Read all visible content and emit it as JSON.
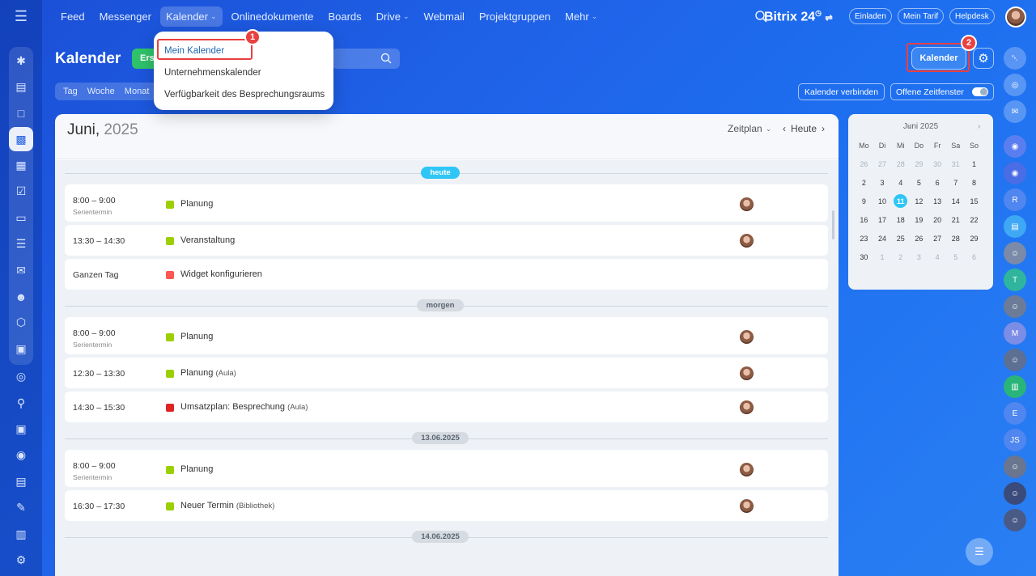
{
  "nav": {
    "items": [
      {
        "label": "Feed",
        "chevron": false,
        "open": false
      },
      {
        "label": "Messenger",
        "chevron": false,
        "open": false
      },
      {
        "label": "Kalender",
        "chevron": true,
        "open": true
      },
      {
        "label": "Onlinedokumente",
        "chevron": false,
        "open": false
      },
      {
        "label": "Boards",
        "chevron": false,
        "open": false
      },
      {
        "label": "Drive",
        "chevron": true,
        "open": false
      },
      {
        "label": "Webmail",
        "chevron": false,
        "open": false
      },
      {
        "label": "Projektgruppen",
        "chevron": false,
        "open": false
      },
      {
        "label": "Mehr",
        "chevron": true,
        "open": false
      }
    ]
  },
  "header": {
    "brand": "Bitrix 24",
    "invite_label": "Einladen",
    "tariff_label": "Mein Tarif",
    "helpdesk_label": "Helpdesk"
  },
  "page": {
    "title": "Kalender",
    "create_label": "Ers",
    "view_tabs": [
      "Tag",
      "Woche",
      "Monat"
    ],
    "kalender_button": "Kalender",
    "connect_label": "Kalender verbinden",
    "open_slots_label": "Offene Zeitfenster"
  },
  "dropdown": {
    "items": [
      "Mein Kalender",
      "Unternehmenskalender",
      "Verfügbarkeit des Besprechungsraums"
    ]
  },
  "badges": {
    "first": "1",
    "second": "2"
  },
  "panel": {
    "month": "Juni,",
    "year": "2025",
    "mode_label": "Zeitplan",
    "today_label": "Heute"
  },
  "days": [
    {
      "label": "heute",
      "color": "#2fc6f6",
      "text_color": "#ffffff",
      "events": [
        {
          "time": "8:00 – 9:00",
          "sub": "Serientermin",
          "title": "Planung",
          "loc": "",
          "color": "#9dcf00",
          "avatar": true
        },
        {
          "time": "13:30 – 14:30",
          "sub": "",
          "title": "Veranstaltung",
          "loc": "",
          "color": "#9dcf00",
          "avatar": true
        },
        {
          "time": "Ganzen Tag",
          "sub": "",
          "title": "Widget konfigurieren",
          "loc": "",
          "color": "#ff5752",
          "avatar": false
        }
      ]
    },
    {
      "label": "morgen",
      "color": "#d5dbe1",
      "text_color": "#5a6470",
      "events": [
        {
          "time": "8:00 – 9:00",
          "sub": "Serientermin",
          "title": "Planung",
          "loc": "",
          "color": "#9dcf00",
          "avatar": true
        },
        {
          "time": "12:30 – 13:30",
          "sub": "",
          "title": "Planung",
          "loc": "(Aula)",
          "color": "#9dcf00",
          "avatar": true
        },
        {
          "time": "14:30 – 15:30",
          "sub": "",
          "title": "Umsatzplan: Besprechung",
          "loc": "(Aula)",
          "color": "#e02424",
          "avatar": true
        }
      ]
    },
    {
      "label": "13.06.2025",
      "color": "#d5dbe1",
      "text_color": "#5a6470",
      "events": [
        {
          "time": "8:00 – 9:00",
          "sub": "Serientermin",
          "title": "Planung",
          "loc": "",
          "color": "#9dcf00",
          "avatar": true
        },
        {
          "time": "16:30 – 17:30",
          "sub": "",
          "title": "Neuer Termin",
          "loc": "(Bibliothek)",
          "color": "#9dcf00",
          "avatar": true
        }
      ]
    },
    {
      "label": "14.06.2025",
      "color": "#d5dbe1",
      "text_color": "#5a6470",
      "events": []
    }
  ],
  "mini_calendar": {
    "title": "Juni 2025",
    "weekdays": [
      "Mo",
      "Di",
      "Mi",
      "Do",
      "Fr",
      "Sa",
      "So"
    ],
    "weeks": [
      [
        [
          "26",
          true
        ],
        [
          "27",
          true
        ],
        [
          "28",
          true
        ],
        [
          "29",
          true
        ],
        [
          "30",
          true
        ],
        [
          "31",
          true
        ],
        [
          "1",
          false
        ]
      ],
      [
        [
          "2",
          false
        ],
        [
          "3",
          false
        ],
        [
          "4",
          false
        ],
        [
          "5",
          false
        ],
        [
          "6",
          false
        ],
        [
          "7",
          false
        ],
        [
          "8",
          false
        ]
      ],
      [
        [
          "9",
          false
        ],
        [
          "10",
          false
        ],
        [
          "11",
          false
        ],
        [
          "12",
          false
        ],
        [
          "13",
          false
        ],
        [
          "14",
          false
        ],
        [
          "15",
          false
        ]
      ],
      [
        [
          "16",
          false
        ],
        [
          "17",
          false
        ],
        [
          "18",
          false
        ],
        [
          "19",
          false
        ],
        [
          "20",
          false
        ],
        [
          "21",
          false
        ],
        [
          "22",
          false
        ]
      ],
      [
        [
          "23",
          false
        ],
        [
          "24",
          false
        ],
        [
          "25",
          false
        ],
        [
          "26",
          false
        ],
        [
          "27",
          false
        ],
        [
          "28",
          false
        ],
        [
          "29",
          false
        ]
      ],
      [
        [
          "30",
          false
        ],
        [
          "1",
          true
        ],
        [
          "2",
          true
        ],
        [
          "3",
          true
        ],
        [
          "4",
          true
        ],
        [
          "5",
          true
        ],
        [
          "6",
          true
        ]
      ]
    ],
    "today": "11"
  },
  "right_rail": [
    {
      "icon": "bell-icon",
      "label": "",
      "color": "rgba(255,255,255,0.25)"
    },
    {
      "icon": "copilot-icon",
      "label": "",
      "color": "rgba(255,255,255,0.25)"
    },
    {
      "icon": "chat-icon",
      "label": "",
      "color": "rgba(255,255,255,0.25)"
    },
    {
      "icon": "copilot-round-icon",
      "label": "",
      "color": "#5a7ef0"
    },
    {
      "icon": "copilot-round-icon",
      "label": "",
      "color": "#4a6de6"
    },
    {
      "icon": "contact-initial",
      "label": "R",
      "color": "#4f86ef"
    },
    {
      "icon": "chat-group-icon",
      "label": "",
      "color": "#3fa8f5"
    },
    {
      "icon": "avatar-photo",
      "label": "",
      "color": "#7a8aa8"
    },
    {
      "icon": "contact-initial",
      "label": "T",
      "color": "#2fb59d"
    },
    {
      "icon": "avatar-photo",
      "label": "",
      "color": "#6b7b98"
    },
    {
      "icon": "contact-initial",
      "label": "M",
      "color": "#7c8de6"
    },
    {
      "icon": "avatar-photo",
      "label": "",
      "color": "#5d6f93"
    },
    {
      "icon": "notes-icon",
      "label": "",
      "color": "#29b57a"
    },
    {
      "icon": "contact-initial",
      "label": "E",
      "color": "#4f86ef"
    },
    {
      "icon": "contact-initial",
      "label": "JS",
      "color": "#4f86ef"
    },
    {
      "icon": "avatar-photo",
      "label": "",
      "color": "#6a7590"
    },
    {
      "icon": "avatar-photo",
      "label": "",
      "color": "#3a4a7a"
    },
    {
      "icon": "avatar-photo",
      "label": "",
      "color": "#4a5a86"
    }
  ]
}
